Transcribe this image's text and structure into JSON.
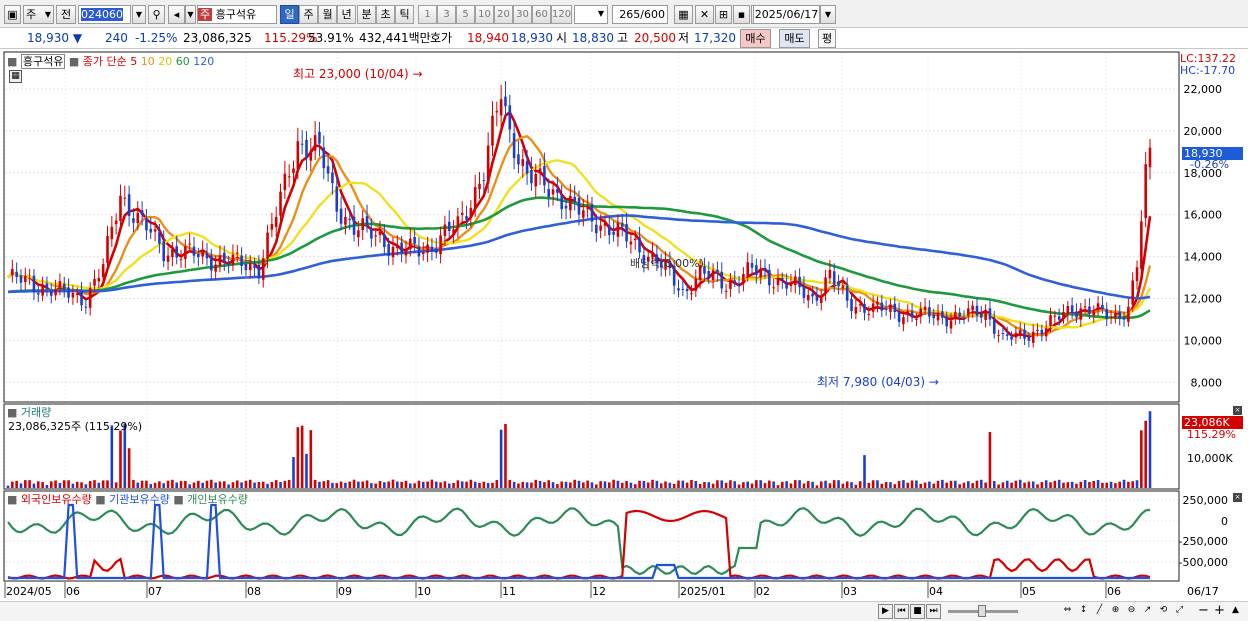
{
  "toolbar": {
    "period_mode": "주",
    "prev_label": "전",
    "code": "024060",
    "stock_badge": "주",
    "stock_name": "흥구석유",
    "periods": [
      "일",
      "주",
      "월",
      "년",
      "분",
      "초",
      "틱"
    ],
    "minutes": [
      "1",
      "3",
      "5",
      "10",
      "20",
      "30",
      "60",
      "120"
    ],
    "count": "265",
    "count_total": "/600",
    "date": "2025/06/17"
  },
  "quote": {
    "price": "18,930",
    "change": "240",
    "change_pct": "-1.25%",
    "volume": "23,086,325",
    "vol_ratio": "115.29%",
    "turnover": "53.91%",
    "amount": "432,441백만",
    "bid_label": "호가",
    "ask": "18,940",
    "bid": "18,930",
    "open_label": "시",
    "open": "18,830",
    "high_label": "고",
    "high": "20,500",
    "low_label": "저",
    "low": "17,320",
    "buy_label": "매수",
    "sell_label": "매도",
    "avg_label": "평"
  },
  "price_panel": {
    "name_tag": "흥구석유",
    "ma_label": "종가 단순",
    "ma_periods": [
      "5",
      "10",
      "20",
      "60",
      "120"
    ],
    "ma_colors": [
      "#d40000",
      "#e8901a",
      "#f0e020",
      "#1e9a3c",
      "#3060d8"
    ],
    "lc": "LC:137.22",
    "hc": "HC:-17.70",
    "price_tag": "18,930",
    "price_tag_pct": "-0.26%",
    "high_annotation": "최고 23,000 (10/04)",
    "low_annotation": "최저 7,980 (04/03)",
    "dividend_annotation": "배당락(0.00%)",
    "y_labels": [
      "22,000",
      "20,000",
      "18,000",
      "16,000",
      "14,000",
      "12,000",
      "10,000",
      "8,000"
    ]
  },
  "volume_panel": {
    "title": "거래량",
    "value": "23,086,325주 (115.29%)",
    "tag": "23,086K",
    "tag_pct": "115.29%",
    "y_label": "10,000K"
  },
  "holdings_panel": {
    "legend": [
      "외국인보유수량",
      "기관보유수량",
      "개인보유수량"
    ],
    "colors": [
      "#d40000",
      "#2050e0",
      "#2e8b57"
    ],
    "y_labels": [
      "250,000",
      "0",
      "-250,000",
      "-500,000"
    ]
  },
  "x_labels": [
    "2024/05",
    "06",
    "07",
    "08",
    "09",
    "10",
    "11",
    "12",
    "2025/01",
    "02",
    "03",
    "04",
    "05",
    "06"
  ],
  "x_last": "06/17",
  "colors": {
    "up": "#d40000",
    "down": "#1a3fd0",
    "highlight": "#1e5bd8"
  }
}
